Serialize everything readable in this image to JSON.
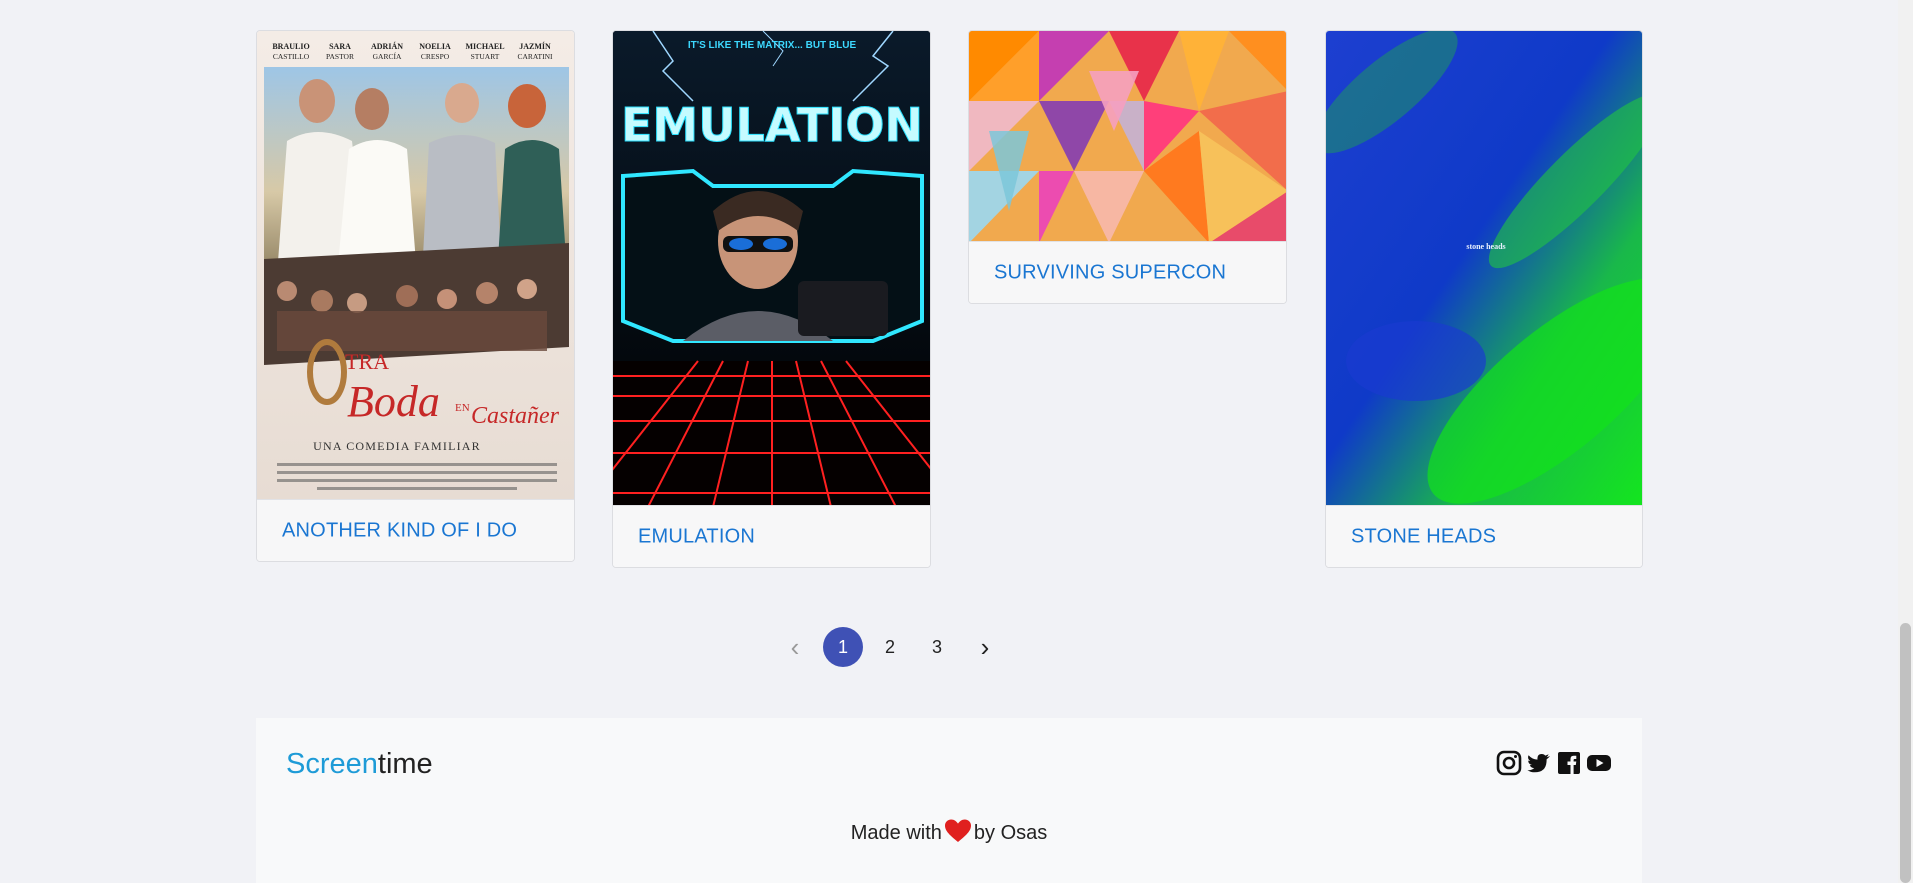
{
  "cards": [
    {
      "title": "ANOTHER KIND OF I DO",
      "poster": {
        "cast": [
          "BRAULIO",
          "SARA",
          "ADRIÁN",
          "NOELIA",
          "MICHAEL",
          "JAZMÍN"
        ],
        "cast_last": [
          "CASTILLO",
          "PASTOR",
          "GARCÍA",
          "CRESPO",
          "STUART",
          "CARATINI"
        ],
        "title_o": "O",
        "title_tra": "TRA",
        "title_boda": "Boda",
        "title_en": "EN",
        "title_place": "Castañer",
        "tagline": "UNA COMEDIA FAMILIAR"
      }
    },
    {
      "title": "EMULATION",
      "poster": {
        "tagline": "IT'S LIKE THE MATRIX... BUT BLUE",
        "name": "EMULATION"
      }
    },
    {
      "title": "SURVIVING SUPERCON"
    },
    {
      "title": "STONE HEADS",
      "poster": {
        "name": "stone heads"
      }
    }
  ],
  "pagination": {
    "prev": "‹",
    "pages": [
      "1",
      "2",
      "3"
    ],
    "active": "1",
    "next": "›"
  },
  "footer": {
    "brand_accent": "Screen",
    "brand_rest": "time",
    "made_prefix": "Made with",
    "made_suffix": "by Osas",
    "social": [
      "instagram-icon",
      "twitter-icon",
      "facebook-icon",
      "youtube-icon"
    ]
  },
  "colors": {
    "link": "#1a76d2",
    "active_page": "#3f51b5",
    "brand": "#1e9bd7",
    "heart": "#e0201f"
  }
}
